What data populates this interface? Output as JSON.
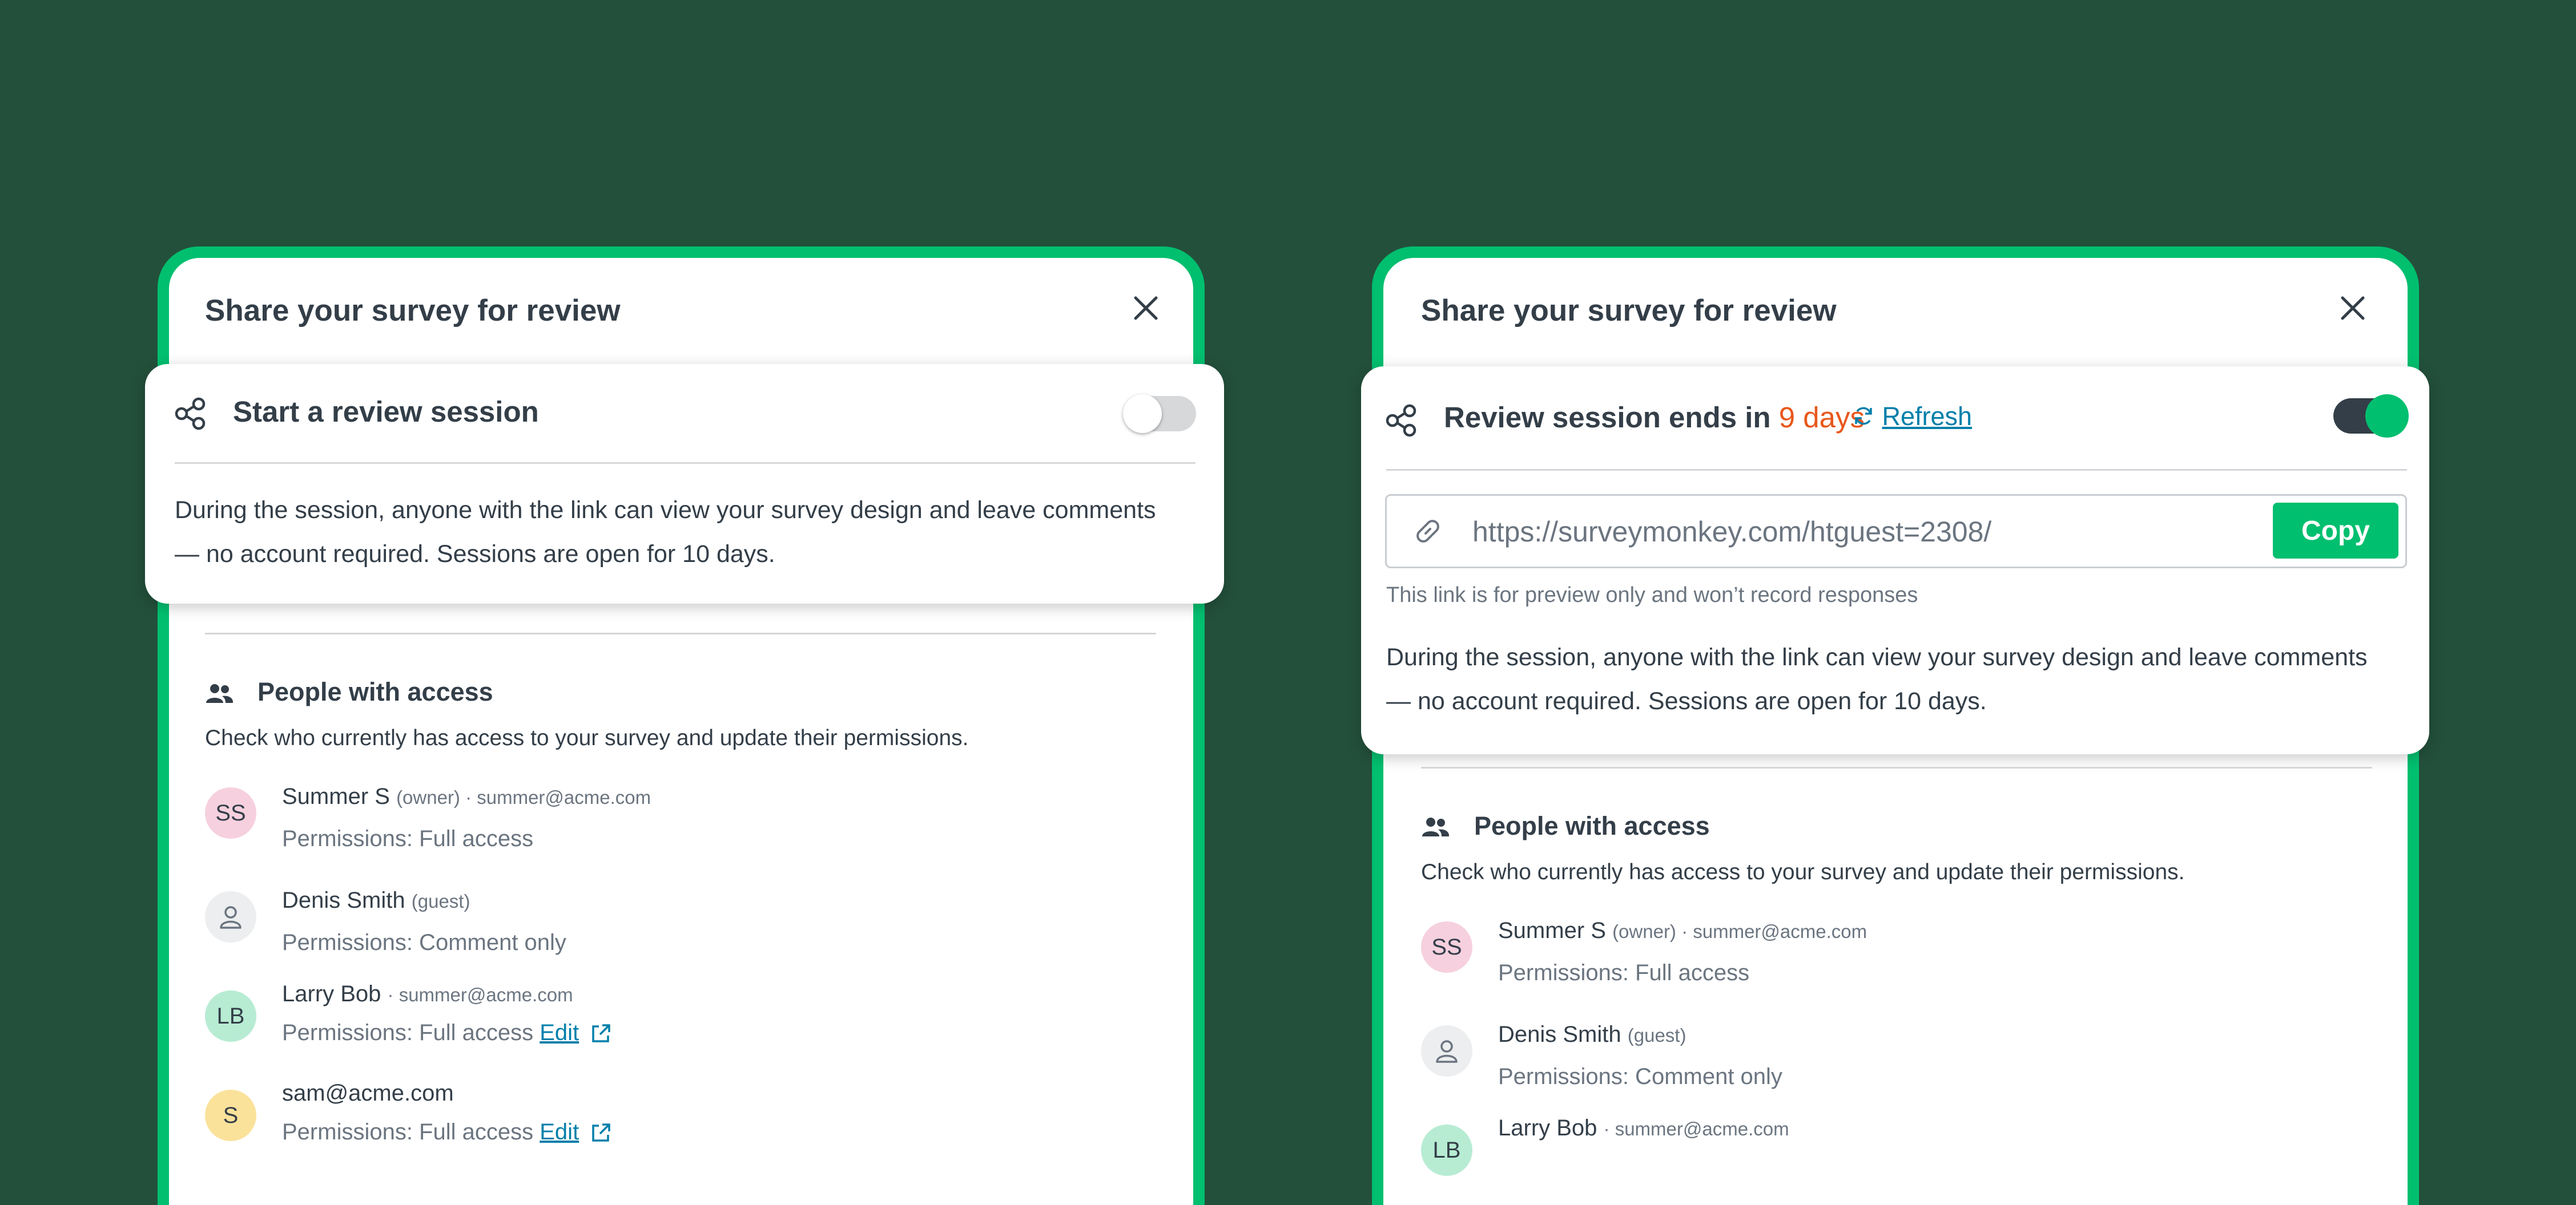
{
  "colors": {
    "background": "#23503b",
    "brand_green": "#00bf6f",
    "text": "#333e48",
    "muted_text": "#6b7580",
    "link": "#007faa",
    "accent_orange": "#e8581c"
  },
  "left": {
    "dialog_title": "Share your survey for review",
    "card_title": "Start a review session",
    "toggle_state": "off",
    "desc_line1": "During the session, anyone with the link can view your survey design and leave comments",
    "desc_line2": "—  no account required. Sessions are open for 10 days.",
    "people_title": "People with access",
    "people_desc": "Check who currently has access to your survey and update their permissions.",
    "people": [
      {
        "initials": "SS",
        "name": "Summer S",
        "meta": "(owner) · summer@acme.com",
        "perm": "Permissions: Full access",
        "edit": "",
        "avatar_color": "#f6d0de",
        "avatar_icon": ""
      },
      {
        "initials": "",
        "name": "Denis Smith",
        "meta": "(guest)",
        "perm": "Permissions: Comment only",
        "edit": "",
        "avatar_color": "#eceeef",
        "avatar_icon": "person-icon"
      },
      {
        "initials": "LB",
        "name": "Larry Bob",
        "meta": "· summer@acme.com",
        "perm": "Permissions: Full access",
        "edit": "Edit",
        "avatar_color": "#b7ecd3",
        "avatar_icon": ""
      },
      {
        "initials": "S",
        "name": "sam@acme.com",
        "meta": "",
        "perm": "Permissions: Full access",
        "edit": "Edit",
        "avatar_color": "#fbe29b",
        "avatar_icon": ""
      }
    ]
  },
  "right": {
    "dialog_title": "Share your survey for review",
    "card_title_prefix": "Review session ends in",
    "card_title_days": "9 days",
    "refresh_label": "Refresh",
    "toggle_state": "on",
    "url": "https://surveymonkey.com/htguest=2308/",
    "copy_label": "Copy",
    "helper_text": "This link is for preview only and won’t record responses",
    "desc_line1": "During the session, anyone with the link can view your survey design and leave comments",
    "desc_line2": "—  no account required. Sessions are open for 10 days.",
    "people_title": "People with access",
    "people_desc": "Check who currently has access to your survey and update their permissions.",
    "people": [
      {
        "initials": "SS",
        "name": "Summer S",
        "meta": "(owner) · summer@acme.com",
        "perm": "Permissions: Full access",
        "edit": "",
        "avatar_color": "#f6d0de",
        "avatar_icon": ""
      },
      {
        "initials": "",
        "name": "Denis Smith",
        "meta": "(guest)",
        "perm": "Permissions: Comment only",
        "edit": "",
        "avatar_color": "#eceeef",
        "avatar_icon": "person-icon"
      },
      {
        "initials": "LB",
        "name": "Larry Bob",
        "meta": "· summer@acme.com",
        "perm": "",
        "edit": "",
        "avatar_color": "#b7ecd3",
        "avatar_icon": ""
      }
    ]
  }
}
